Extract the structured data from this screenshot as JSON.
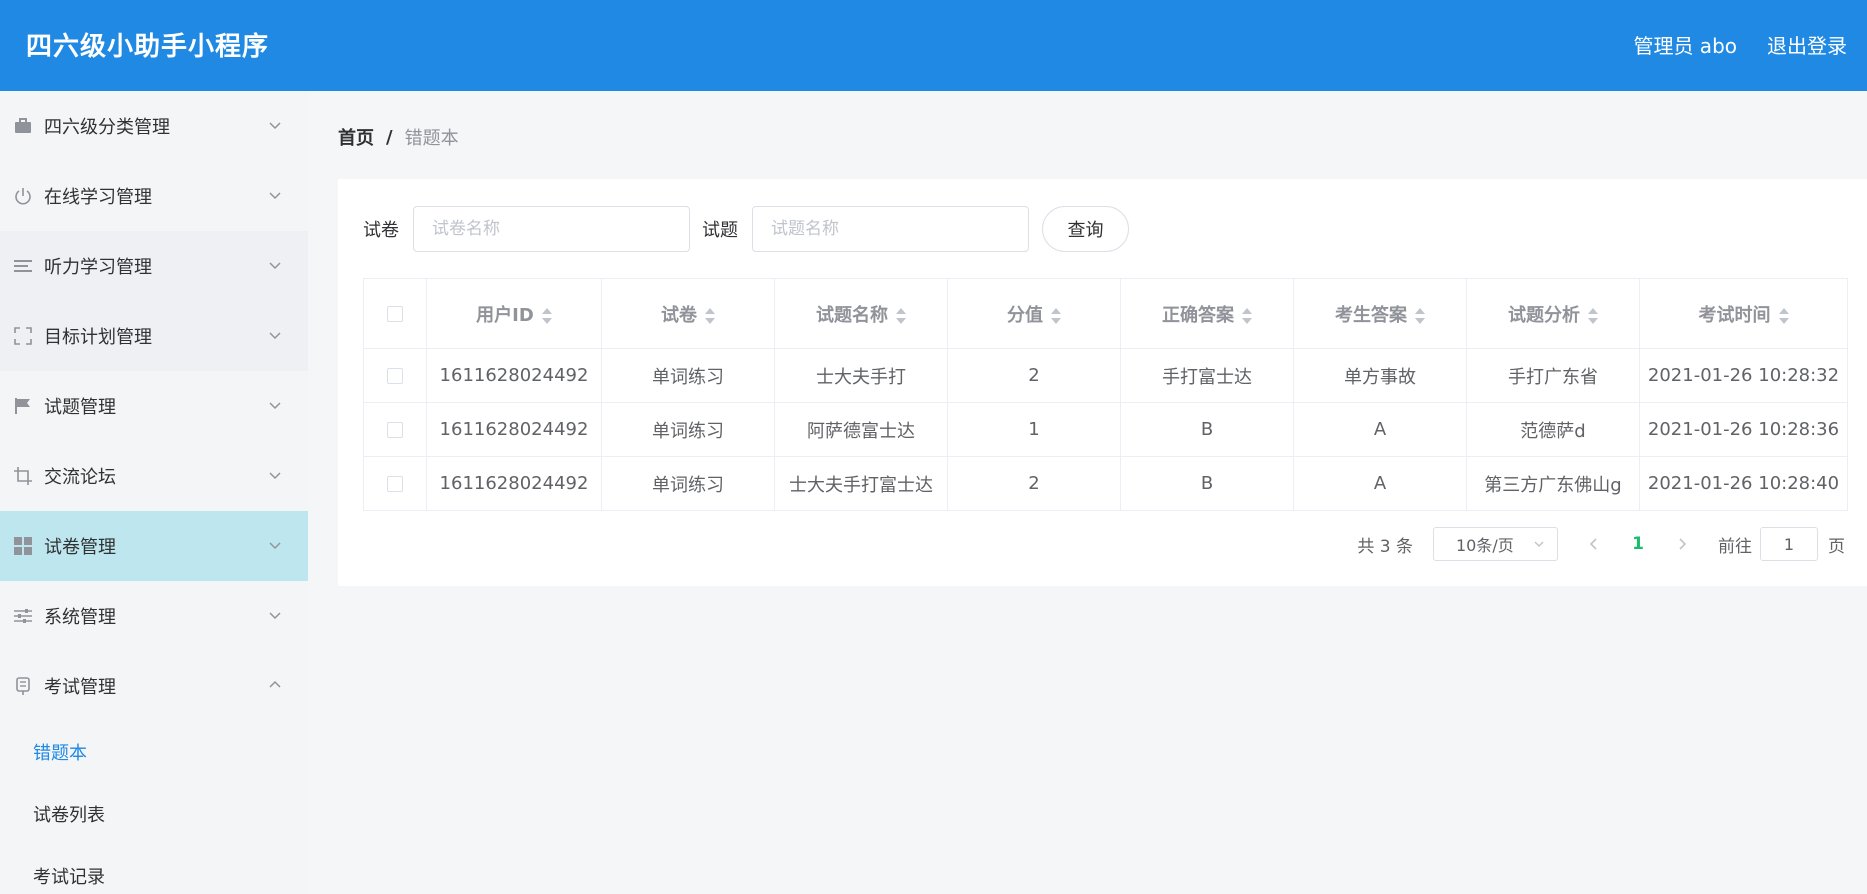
{
  "header": {
    "title": "四六级小助手小程序",
    "admin_label": "管理员 abo",
    "logout_label": "退出登录",
    "bg_color": "#2089e3"
  },
  "sidebar": {
    "items": [
      {
        "label": "四六级分类管理",
        "icon": "briefcase-icon",
        "expanded": false
      },
      {
        "label": "在线学习管理",
        "icon": "power-icon",
        "expanded": false
      },
      {
        "label": "听力学习管理",
        "icon": "list-icon",
        "expanded": false
      },
      {
        "label": "目标计划管理",
        "icon": "frame-icon",
        "expanded": false
      },
      {
        "label": "试题管理",
        "icon": "flag-icon",
        "expanded": false
      },
      {
        "label": "交流论坛",
        "icon": "crop-icon",
        "expanded": false
      },
      {
        "label": "试卷管理",
        "icon": "grid-icon",
        "expanded": false,
        "highlighted": true
      },
      {
        "label": "系统管理",
        "icon": "sliders-icon",
        "expanded": false
      },
      {
        "label": "考试管理",
        "icon": "phone-icon",
        "expanded": true
      }
    ],
    "sub_items": [
      {
        "label": "错题本",
        "current": true
      },
      {
        "label": "试卷列表",
        "current": false
      },
      {
        "label": "考试记录",
        "current": false
      }
    ],
    "active_color": "#bde6ee"
  },
  "breadcrumb": {
    "home": "首页",
    "separator": "/",
    "current": "错题本"
  },
  "filters": {
    "paper_label": "试卷",
    "paper_placeholder": "试卷名称",
    "question_label": "试题",
    "question_placeholder": "试题名称",
    "query_button": "查询"
  },
  "table": {
    "columns": [
      "用户ID",
      "试卷",
      "试题名称",
      "分值",
      "正确答案",
      "考生答案",
      "试题分析",
      "考试时间"
    ],
    "rows": [
      [
        "1611628024492",
        "单词练习",
        "士大夫手打",
        "2",
        "手打富士达",
        "单方事故",
        "手打广东省",
        "2021-01-26 10:28:32"
      ],
      [
        "1611628024492",
        "单词练习",
        "阿萨德富士达",
        "1",
        "B",
        "A",
        "范德萨d",
        "2021-01-26 10:28:36"
      ],
      [
        "1611628024492",
        "单词练习",
        "士大夫手打富士达",
        "2",
        "B",
        "A",
        "第三方广东佛山g",
        "2021-01-26 10:28:40"
      ]
    ]
  },
  "pagination": {
    "total": "共 3 条",
    "page_size": "10条/页",
    "current_page": "1",
    "goto_label": "前往",
    "goto_value": "1",
    "page_suffix": "页",
    "active_color": "#19be6b"
  }
}
